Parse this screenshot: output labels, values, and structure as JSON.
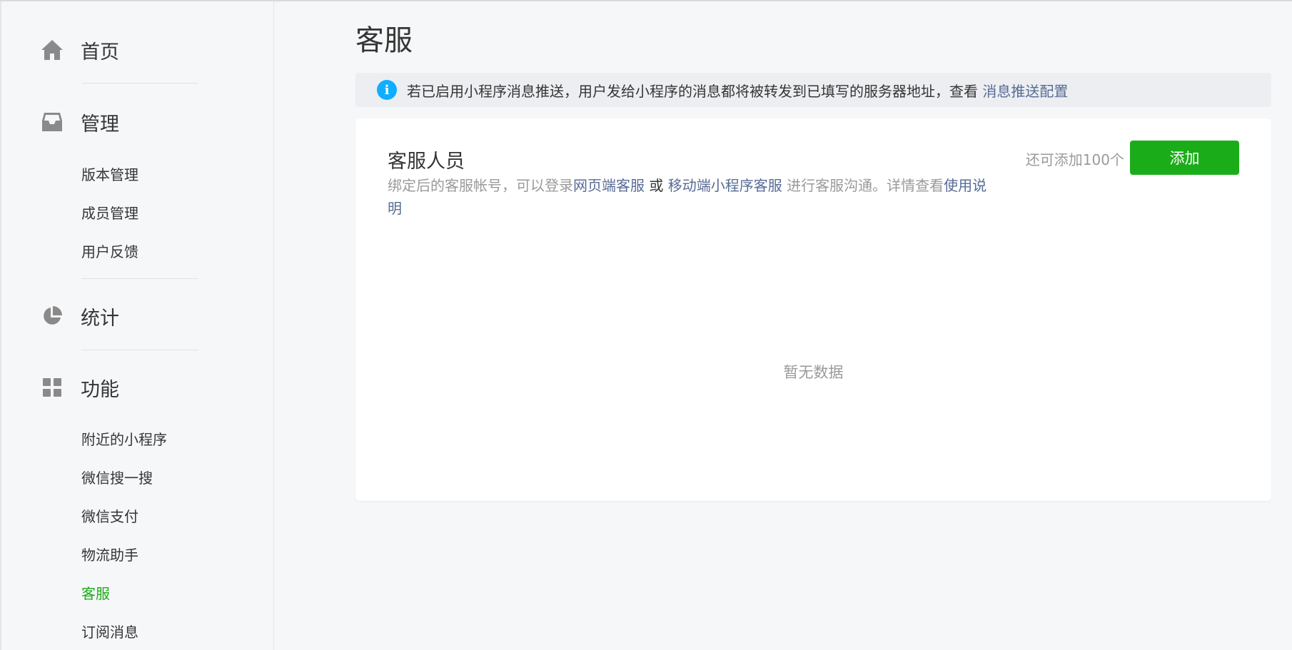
{
  "sidebar": {
    "sections": [
      {
        "key": "home",
        "label": "首页",
        "icon": "home-icon"
      },
      {
        "key": "manage",
        "label": "管理",
        "icon": "inbox-icon"
      },
      {
        "key": "stats",
        "label": "统计",
        "icon": "pie-chart-icon"
      },
      {
        "key": "features",
        "label": "功能",
        "icon": "grid-icon"
      }
    ],
    "manage_items": [
      "版本管理",
      "成员管理",
      "用户反馈"
    ],
    "feature_items": [
      "附近的小程序",
      "微信搜一搜",
      "微信支付",
      "物流助手",
      "客服",
      "订阅消息"
    ],
    "active_item": "客服"
  },
  "main": {
    "title": "客服",
    "notice": {
      "text": "若已启用小程序消息推送，用户发给小程序的消息都将被转发到已填写的服务器地址，查看",
      "link": "消息推送配置"
    },
    "card": {
      "title": "客服人员",
      "desc_part1": "绑定后的客服帐号，可以登录",
      "desc_link1": "网页端客服",
      "desc_or": " 或 ",
      "desc_link2": "移动端小程序客服",
      "desc_part2": " 进行客服沟通。详情查看",
      "desc_link3": "使用说明",
      "quota_text": "还可添加100个",
      "add_label": "添加",
      "empty_text": "暂无数据"
    }
  },
  "colors": {
    "accent": "#1aad19",
    "link": "#576b95",
    "info": "#10aeff"
  }
}
